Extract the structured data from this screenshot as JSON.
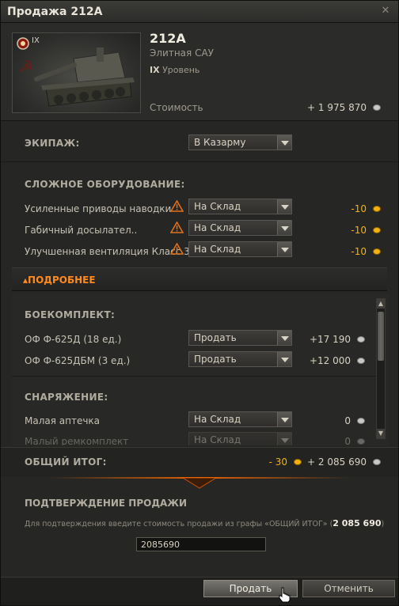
{
  "window": {
    "title": "Продажа 212А",
    "close_glyph": "✕"
  },
  "vehicle": {
    "tier_badge": "IX",
    "name": "212А",
    "class": "Элитная САУ",
    "level_numeral": "IX",
    "level_label": "Уровень",
    "cost_label": "Стоимость",
    "cost_value": "+ 1 975 870",
    "cost_icon": "credits-icon"
  },
  "crew": {
    "header": "ЭКИПАЖ:",
    "selected": "В Казарму"
  },
  "equipment": {
    "header": "СЛОЖНОЕ ОБОРУДОВАНИЕ:",
    "items": [
      {
        "label": "Усиленные приводы наводки",
        "selected": "На Склад",
        "value": "-10",
        "icon": "gold-icon"
      },
      {
        "label": "Габичный досылател..",
        "selected": "На Склад",
        "value": "-10",
        "icon": "gold-icon"
      },
      {
        "label": "Улучшенная вентиляция Класс 3",
        "selected": "На Склад",
        "value": "-10",
        "icon": "gold-icon"
      }
    ]
  },
  "details": {
    "label": "ПОДРОБНЕЕ",
    "arrow_glyph": "▴"
  },
  "ammo": {
    "header": "БОЕКОМПЛЕКТ:",
    "items": [
      {
        "label": "ОФ Ф-625Д (18 ед.)",
        "selected": "Продать",
        "value": "+17 190",
        "icon": "credits-icon"
      },
      {
        "label": "ОФ Ф-625ДБМ (3 ед.)",
        "selected": "Продать",
        "value": "+12 000",
        "icon": "credits-icon"
      }
    ]
  },
  "consumables": {
    "header": "СНАРЯЖЕНИЕ:",
    "items": [
      {
        "label": "Малая аптечка",
        "selected": "На Склад",
        "value": "0",
        "icon": "credits-icon"
      },
      {
        "label": "Малый ремкомплект",
        "selected": "На Склад",
        "value": "0",
        "icon": "credits-icon"
      }
    ]
  },
  "scrollbar": {
    "up_glyph": "▲",
    "down_glyph": "▼"
  },
  "total": {
    "label": "ОБЩИЙ ИТОГ:",
    "gold_value": "- 30",
    "credits_value": "+ 2 085 690"
  },
  "confirm": {
    "header": "ПОДТВЕРЖДЕНИЕ ПРОДАЖИ",
    "instruction": "Для подтверждения введите стоимость продажи из графы «ОБЩИЙ ИТОГ» (",
    "amount": "2 085 690",
    "closing": ")",
    "input_value": "2085690"
  },
  "buttons": {
    "sell": "Продать",
    "cancel": "Отменить"
  },
  "colors": {
    "accent_orange": "#ff8a1e",
    "gold": "#f2b211",
    "text": "#d8d2c2"
  }
}
